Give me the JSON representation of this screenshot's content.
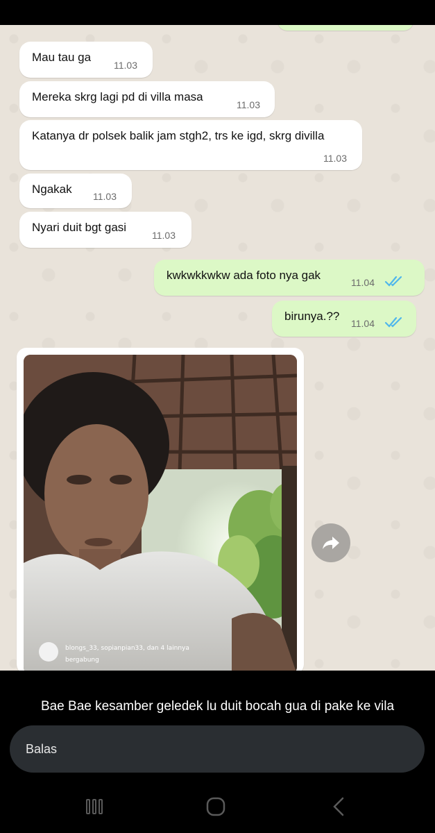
{
  "messages": [
    {
      "text": "Mau tau ga",
      "time": "11.03"
    },
    {
      "text": "Mereka skrg lagi pd di villa masa",
      "time": "11.03"
    },
    {
      "text": "Katanya dr polsek balik jam stgh2, trs ke igd, skrg divilla",
      "time": "11.03"
    },
    {
      "text": "Ngakak",
      "time": "11.03"
    },
    {
      "text": "Nyari duit bgt gasi",
      "time": "11.03"
    },
    {
      "text": "kwkwkkwkw ada foto nya gak",
      "time": "11.04"
    },
    {
      "text": "birunya.??",
      "time": "11.04"
    }
  ],
  "photo": {
    "overlay_line1": "blongs_33, sopianpian33, dan 4 lainnya",
    "overlay_line2": "bergabung"
  },
  "reply": {
    "caption": "Bae Bae kesamber geledek lu duit bocah gua di pake ke vila",
    "placeholder": "Balas"
  },
  "icons": {
    "forward": "forward-share-icon",
    "read_receipt": "double-check-icon",
    "nav": [
      "recent-apps-icon",
      "home-icon",
      "back-icon"
    ]
  },
  "colors": {
    "read_tick": "#4fb6ec",
    "outgoing_bubble": "#dcf8c6",
    "chat_background": "#e9e3da"
  }
}
